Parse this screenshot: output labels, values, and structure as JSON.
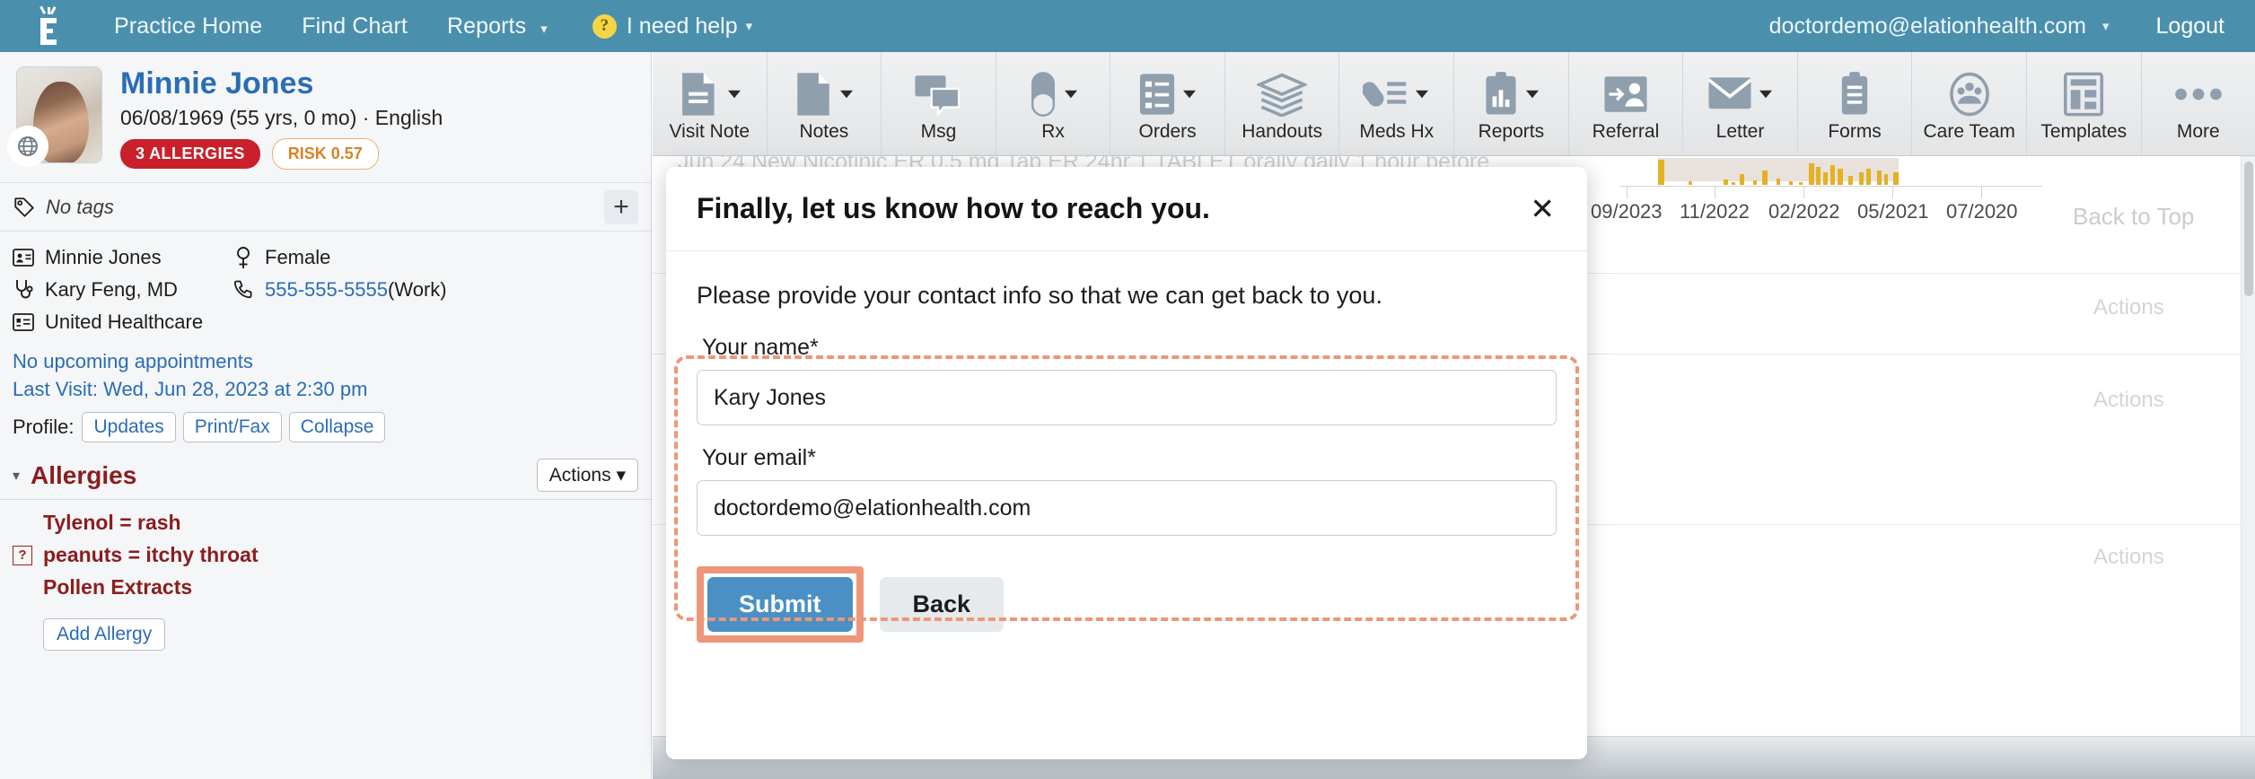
{
  "topnav": {
    "logo": "elation-logo-icon",
    "links": [
      {
        "label": "Practice Home",
        "caret": false
      },
      {
        "label": "Find Chart",
        "caret": false
      },
      {
        "label": "Reports",
        "caret": true
      }
    ],
    "help": {
      "icon": "question-mark-icon",
      "label": "I need help",
      "caret": "▾"
    },
    "user_email": "doctordemo@elationhealth.com",
    "user_caret": "▾",
    "logout": "Logout",
    "bg_color": "#4a90ad"
  },
  "patient": {
    "name": "Minnie Jones",
    "dob_line": "06/08/1969 (55 yrs, 0 mo) · English",
    "allergy_badge": "3 ALLERGIES",
    "risk_badge": "RISK 0.57",
    "allergy_badge_color": "#c9202b",
    "risk_badge_color": "#d98224",
    "tags_text": "No tags",
    "add_tag": "+",
    "info": [
      {
        "icon": "id-card-icon",
        "text": "Minnie Jones",
        "link": false
      },
      {
        "icon": "female-sign-icon",
        "text": "Female",
        "link": false
      },
      {
        "icon": "stethoscope-icon",
        "text": "Kary Feng, MD",
        "link": false
      },
      {
        "icon": "phone-icon",
        "text": "555-555-5555",
        "suffix": " (Work)",
        "link": true
      },
      {
        "icon": "insurance-card-icon",
        "text": "United Healthcare",
        "link": false
      }
    ],
    "no_appointments": "No upcoming appointments",
    "last_visit": "Last Visit: Wed, Jun 28, 2023 at 2:30 pm",
    "profile_label": "Profile:",
    "profile_buttons": [
      "Updates",
      "Print/Fax",
      "Collapse"
    ],
    "allergies_section": {
      "caret": "▾",
      "title": "Allergies",
      "actions_label": "Actions",
      "actions_caret": "▾",
      "items": [
        {
          "text": "Tylenol = rash",
          "flagged": false
        },
        {
          "text": "peanuts = itchy throat",
          "flagged": true,
          "flag": "?"
        },
        {
          "text": "Pollen Extracts",
          "flagged": false
        }
      ],
      "add_label": "Add Allergy"
    }
  },
  "toolbar": {
    "items": [
      {
        "label": "Visit Note",
        "icon": "document-lines-icon",
        "caret": true
      },
      {
        "label": "Notes",
        "icon": "document-icon",
        "caret": true
      },
      {
        "label": "Msg",
        "icon": "chat-bubbles-icon",
        "caret": false
      },
      {
        "label": "Rx",
        "icon": "pill-capsule-icon",
        "caret": true
      },
      {
        "label": "Orders",
        "icon": "checklist-icon",
        "caret": true
      },
      {
        "label": "Handouts",
        "icon": "stacked-sheets-icon",
        "caret": false
      },
      {
        "label": "Meds Hx",
        "icon": "pill-list-icon",
        "caret": true
      },
      {
        "label": "Reports",
        "icon": "clipboard-chart-icon",
        "caret": true
      },
      {
        "label": "Referral",
        "icon": "person-arrow-icon",
        "caret": false
      },
      {
        "label": "Letter",
        "icon": "envelope-icon",
        "caret": true
      },
      {
        "label": "Forms",
        "icon": "clipboard-icon",
        "caret": false
      },
      {
        "label": "Care Team",
        "icon": "people-circle-icon",
        "caret": false
      },
      {
        "label": "Templates",
        "icon": "template-layout-icon",
        "caret": false
      },
      {
        "label": "More",
        "icon": "ellipsis-icon",
        "caret": false
      }
    ]
  },
  "background": {
    "faint_text_top": "Jun 24          New Nicotinic ER 0.5 mg Tab ER 24hr 1 TABLET orally daily 1 hour before",
    "back_to_top": "Back to Top",
    "actions_label": "Actions",
    "actions_rows": 3
  },
  "chart_data": {
    "type": "bar",
    "title": "",
    "xlabel": "",
    "ylabel": "",
    "categories": [
      "09/2023",
      "11/2022",
      "02/2022",
      "05/2021",
      "07/2020"
    ],
    "tick_labels": [
      "09/2023",
      "11/2022",
      "02/2022",
      "05/2021",
      "07/2020"
    ],
    "values": [
      28,
      4,
      6,
      3,
      12,
      5,
      16,
      7,
      4,
      3,
      24,
      20,
      14,
      22,
      18,
      10,
      14,
      18,
      16,
      12,
      14
    ],
    "bar_color": "#e3b122",
    "band_color": "#e5dcd6",
    "grid": false,
    "legend": "none"
  },
  "modal": {
    "title": "Finally, let us know how to reach you.",
    "close_icon": "close-icon",
    "close_glyph": "✕",
    "subtitle": "Please provide your contact info so that we can get back to you.",
    "fields": [
      {
        "label": "Your name*",
        "value": "Kary Jones",
        "placeholder": ""
      },
      {
        "label": "Your email*",
        "value": "doctordemo@elationhealth.com",
        "placeholder": ""
      }
    ],
    "submit_label": "Submit",
    "back_label": "Back",
    "submit_color": "#4a90c4",
    "highlight_color": "#ef9679"
  }
}
